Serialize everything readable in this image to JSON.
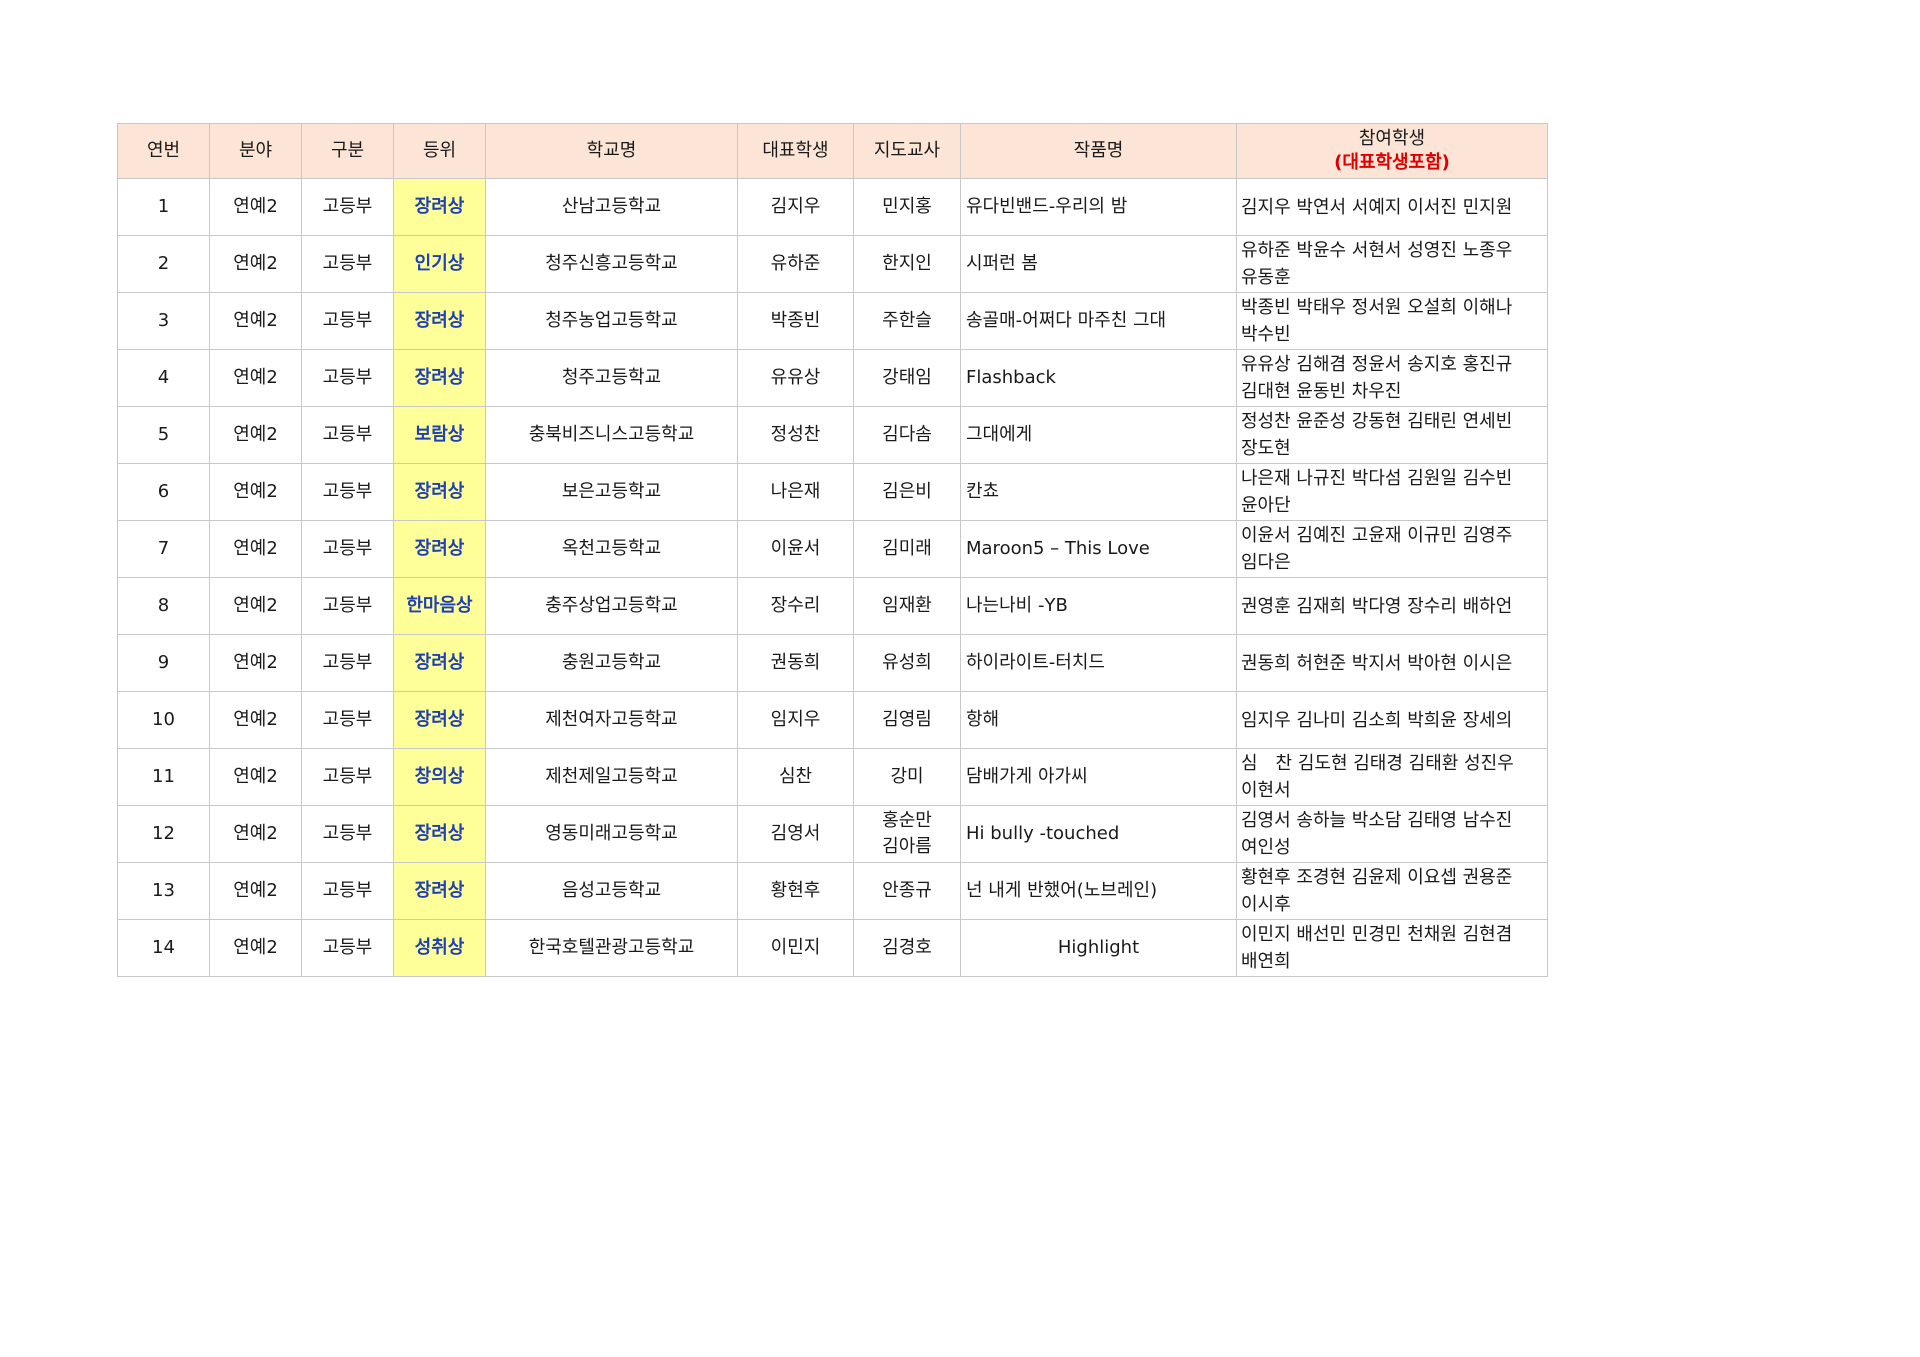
{
  "headers": {
    "no": "연번",
    "field": "분야",
    "division": "구분",
    "rank": "등위",
    "school": "학교명",
    "representative": "대표학생",
    "teacher": "지도교사",
    "work": "작품명",
    "members": "참여학생",
    "members_note": "(대표학생포함)"
  },
  "rows": [
    {
      "no": "1",
      "field": "연예2",
      "division": "고등부",
      "rank": "장려상",
      "school": "산남고등학교",
      "representative": "김지우",
      "teachers": [
        "민지홍"
      ],
      "work": "유다빈밴드-우리의 밤",
      "members": "김지우 박연서 서예지 이서진 민지원"
    },
    {
      "no": "2",
      "field": "연예2",
      "division": "고등부",
      "rank": "인기상",
      "school": "청주신흥고등학교",
      "representative": "유하준",
      "teachers": [
        "한지인"
      ],
      "work": "시퍼런 봄",
      "members": "유하준 박윤수 서현서 성영진 노종우 유동훈"
    },
    {
      "no": "3",
      "field": "연예2",
      "division": "고등부",
      "rank": "장려상",
      "school": "청주농업고등학교",
      "representative": "박종빈",
      "teachers": [
        "주한슬"
      ],
      "work": "송골매-어쩌다 마주친 그대",
      "members": "박종빈 박태우 정서원 오설희 이해나 박수빈"
    },
    {
      "no": "4",
      "field": "연예2",
      "division": "고등부",
      "rank": "장려상",
      "school": "청주고등학교",
      "representative": "유유상",
      "teachers": [
        "강태임"
      ],
      "work": "Flashback",
      "members": "유유상 김해겸 정윤서 송지호 홍진규 김대현 윤동빈 차우진"
    },
    {
      "no": "5",
      "field": "연예2",
      "division": "고등부",
      "rank": "보람상",
      "school": "충북비즈니스고등학교",
      "representative": "정성찬",
      "teachers": [
        "김다솜"
      ],
      "work": "그대에게",
      "members": "정성찬 윤준성 강동현 김태린 연세빈 장도현"
    },
    {
      "no": "6",
      "field": "연예2",
      "division": "고등부",
      "rank": "장려상",
      "school": "보은고등학교",
      "representative": "나은재",
      "teachers": [
        "김은비"
      ],
      "work": "칸쵸",
      "members": "나은재 나규진 박다섬 김원일 김수빈 윤아단"
    },
    {
      "no": "7",
      "field": "연예2",
      "division": "고등부",
      "rank": "장려상",
      "school": "옥천고등학교",
      "representative": "이윤서",
      "teachers": [
        "김미래"
      ],
      "work": "Maroon5 – This Love",
      "members": "이윤서 김예진 고윤재 이규민 김영주 임다은"
    },
    {
      "no": "8",
      "field": "연예2",
      "division": "고등부",
      "rank": "한마음상",
      "school": "충주상업고등학교",
      "representative": "장수리",
      "teachers": [
        "임재환"
      ],
      "work": "나는나비 -YB",
      "members": "권영훈 김재희 박다영 장수리 배하언"
    },
    {
      "no": "9",
      "field": "연예2",
      "division": "고등부",
      "rank": "장려상",
      "school": "충원고등학교",
      "representative": "권동희",
      "teachers": [
        "유성희"
      ],
      "work": "하이라이트-터치드",
      "members": "권동희 허현준 박지서 박아현 이시은"
    },
    {
      "no": "10",
      "field": "연예2",
      "division": "고등부",
      "rank": "장려상",
      "school": "제천여자고등학교",
      "representative": "임지우",
      "teachers": [
        "김영림"
      ],
      "work": "항해",
      "members": "임지우 김나미 김소희 박희윤 장세의"
    },
    {
      "no": "11",
      "field": "연예2",
      "division": "고등부",
      "rank": "창의상",
      "school": "제천제일고등학교",
      "representative": "심찬",
      "teachers": [
        "강미"
      ],
      "work": "담배가게 아가씨",
      "members": "심　찬 김도현 김태경 김태환 성진우 이현서"
    },
    {
      "no": "12",
      "field": "연예2",
      "division": "고등부",
      "rank": "장려상",
      "school": "영동미래고등학교",
      "representative": "김영서",
      "teachers": [
        "홍순만",
        "김아름"
      ],
      "work": "Hi bully -touched",
      "members": "김영서 송하늘 박소담 김태영 남수진 여인성"
    },
    {
      "no": "13",
      "field": "연예2",
      "division": "고등부",
      "rank": "장려상",
      "school": "음성고등학교",
      "representative": "황현후",
      "teachers": [
        "안종규"
      ],
      "work": "넌 내게 반했어(노브레인)",
      "members": "황현후 조경현 김윤제 이요셉 권용준 이시후"
    },
    {
      "no": "14",
      "field": "연예2",
      "division": "고등부",
      "rank": "성취상",
      "school": "한국호텔관광고등학교",
      "representative": "이민지",
      "teachers": [
        "김경호"
      ],
      "work": "Highlight",
      "members": "이민지 배선민 민경민 천채원 김현겸 배연희",
      "work_align": "center"
    }
  ]
}
